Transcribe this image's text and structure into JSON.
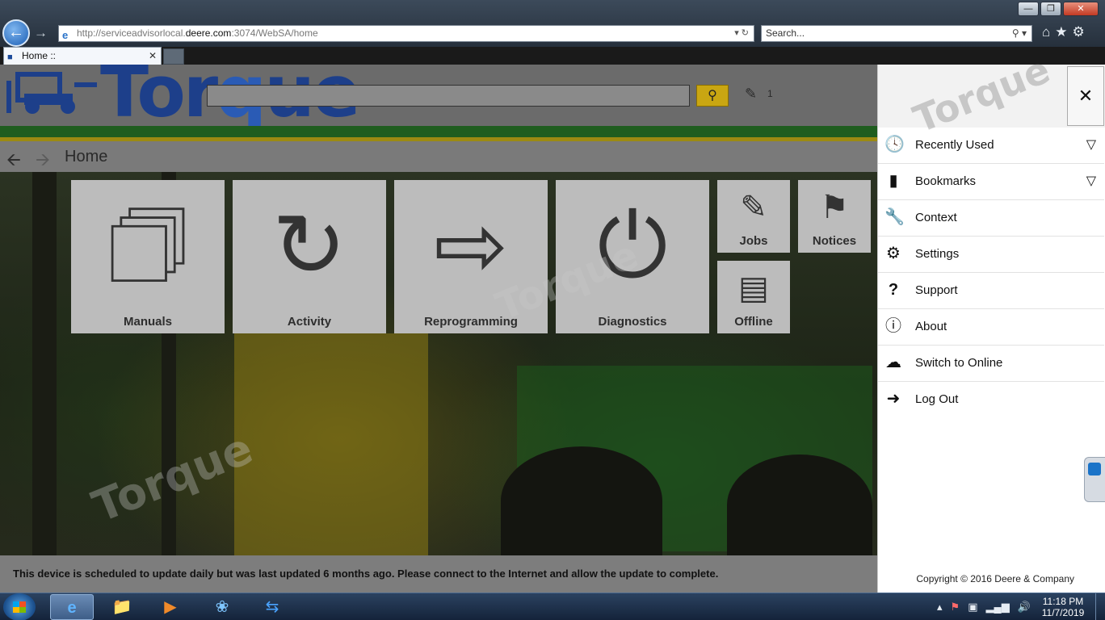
{
  "browser": {
    "url_prefix": "http://serviceadvisorlocal.",
    "url_domain": "deere.com",
    "url_suffix": ":3074/WebSA/home",
    "search_placeholder": "Search...",
    "tab_title": "Home ::",
    "window_buttons": [
      "—",
      "❐",
      "✕"
    ]
  },
  "header": {
    "logo_text_a": "Tor",
    "logo_text_gear": "q",
    "logo_text_b": "ue",
    "jobs_count": "1"
  },
  "breadcrumb": {
    "current": "Home"
  },
  "tiles": [
    {
      "label": "Manuals",
      "icon": "manuals-icon"
    },
    {
      "label": "Activity",
      "icon": "activity-icon"
    },
    {
      "label": "Reprogramming",
      "icon": "reprogramming-icon"
    },
    {
      "label": "Diagnostics",
      "icon": "diagnostics-icon"
    },
    {
      "label": "Jobs",
      "icon": "jobs-icon"
    },
    {
      "label": "Notices",
      "icon": "notices-icon"
    },
    {
      "label": "Offline",
      "icon": "offline-icon"
    }
  ],
  "notice": "This device is scheduled to update daily but was last updated 6 months ago. Please connect to the Internet and allow the update to complete.",
  "panel": {
    "close": "✕",
    "items": [
      {
        "label": "Recently Used",
        "icon": "clock-icon",
        "expandable": true
      },
      {
        "label": "Bookmarks",
        "icon": "bookmark-icon",
        "expandable": true
      },
      {
        "label": "Context",
        "icon": "wrench-icon",
        "expandable": false
      },
      {
        "label": "Settings",
        "icon": "gear-icon",
        "expandable": false
      },
      {
        "label": "Support",
        "icon": "question-icon",
        "expandable": false
      },
      {
        "label": "About",
        "icon": "info-icon",
        "expandable": false
      },
      {
        "label": "Switch to Online",
        "icon": "cloud-icon",
        "expandable": false
      },
      {
        "label": "Log Out",
        "icon": "logout-icon",
        "expandable": false
      }
    ],
    "copyright": "Copyright © 2016 Deere & Company"
  },
  "taskbar": {
    "time": "11:18 PM",
    "date": "11/7/2019"
  },
  "watermark": "Torque"
}
